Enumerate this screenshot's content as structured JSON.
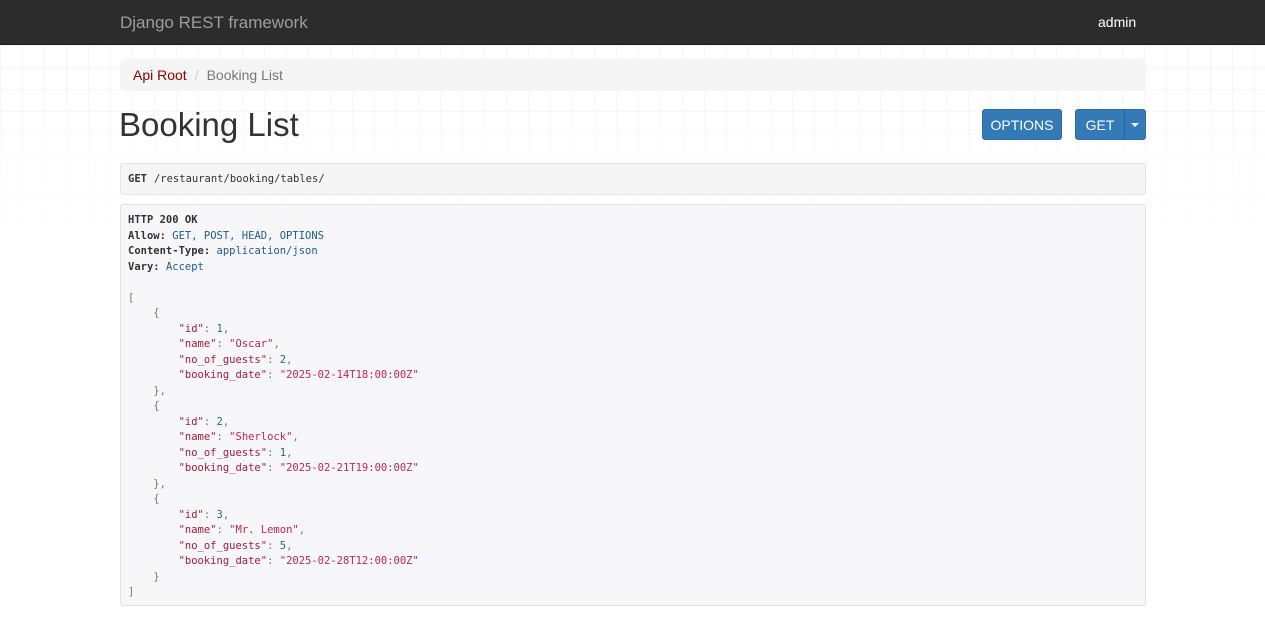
{
  "navbar": {
    "brand": "Django REST framework",
    "user": "admin"
  },
  "breadcrumb": {
    "root": "Api Root",
    "separator": "/",
    "current": "Booking List"
  },
  "page": {
    "title": "Booking List"
  },
  "buttons": {
    "options": "OPTIONS",
    "get": "GET"
  },
  "request": {
    "method": "GET",
    "path": "/restaurant/booking/tables/"
  },
  "response": {
    "status": "HTTP 200 OK",
    "headers": [
      {
        "key": "Allow:",
        "value": "GET, POST, HEAD, OPTIONS"
      },
      {
        "key": "Content-Type:",
        "value": "application/json"
      },
      {
        "key": "Vary:",
        "value": "Accept"
      }
    ],
    "bookings": [
      {
        "id": "1",
        "name": "\"Oscar\"",
        "no_of_guests": "2",
        "booking_date": "\"2025-02-14T18:00:00Z\""
      },
      {
        "id": "2",
        "name": "\"Sherlock\"",
        "no_of_guests": "1",
        "booking_date": "\"2025-02-21T19:00:00Z\""
      },
      {
        "id": "3",
        "name": "\"Mr. Lemon\"",
        "no_of_guests": "5",
        "booking_date": "\"2025-02-28T12:00:00Z\""
      }
    ],
    "json_keys": {
      "id": "\"id\"",
      "name": "\"name\"",
      "no_of_guests": "\"no_of_guests\"",
      "booking_date": "\"booking_date\""
    },
    "brackets": {
      "open": "[",
      "close": "]",
      "obj_open": "{",
      "obj_close": "}"
    }
  }
}
